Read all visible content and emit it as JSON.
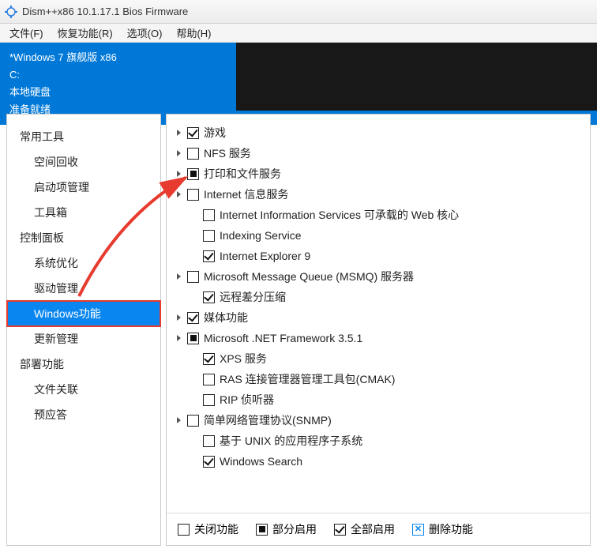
{
  "window": {
    "title": "Dism++x86 10.1.17.1 Bios Firmware"
  },
  "menu": {
    "file": "文件(F)",
    "recovery": "恢复功能(R)",
    "options": "选项(O)",
    "help": "帮助(H)"
  },
  "info": {
    "os": "*Windows 7 旗舰版 x86",
    "drive": "C:",
    "disk": "本地硬盘",
    "status": "准备就绪"
  },
  "sidebar": {
    "groups": [
      {
        "head": "常用工具",
        "items": [
          "空间回收",
          "启动项管理",
          "工具箱"
        ]
      },
      {
        "head": "控制面板",
        "items": [
          "系统优化",
          "驱动管理",
          "Windows功能",
          "更新管理"
        ]
      },
      {
        "head": "部署功能",
        "items": [
          "文件关联",
          "预应答"
        ]
      }
    ],
    "selected": "Windows功能"
  },
  "features": [
    {
      "expand": true,
      "check": "checked",
      "label": "游戏",
      "indent": 0
    },
    {
      "expand": true,
      "check": "none",
      "label": "NFS 服务",
      "indent": 0
    },
    {
      "expand": true,
      "check": "partial",
      "label": "打印和文件服务",
      "indent": 0
    },
    {
      "expand": true,
      "check": "none",
      "label": "Internet 信息服务",
      "indent": 0
    },
    {
      "expand": false,
      "check": "none",
      "label": "Internet Information Services 可承载的 Web 核心",
      "indent": 1
    },
    {
      "expand": false,
      "check": "none",
      "label": "Indexing Service",
      "indent": 1
    },
    {
      "expand": false,
      "check": "checked",
      "label": "Internet Explorer 9",
      "indent": 1
    },
    {
      "expand": true,
      "check": "none",
      "label": "Microsoft Message Queue (MSMQ) 服务器",
      "indent": 0
    },
    {
      "expand": false,
      "check": "checked",
      "label": "远程差分压缩",
      "indent": 1
    },
    {
      "expand": true,
      "check": "checked",
      "label": "媒体功能",
      "indent": 0
    },
    {
      "expand": true,
      "check": "partial",
      "label": "Microsoft .NET Framework 3.5.1",
      "indent": 0
    },
    {
      "expand": false,
      "check": "checked",
      "label": "XPS 服务",
      "indent": 1
    },
    {
      "expand": false,
      "check": "none",
      "label": "RAS 连接管理器管理工具包(CMAK)",
      "indent": 1
    },
    {
      "expand": false,
      "check": "none",
      "label": "RIP 侦听器",
      "indent": 1
    },
    {
      "expand": true,
      "check": "none",
      "label": "简单网络管理协议(SNMP)",
      "indent": 0
    },
    {
      "expand": false,
      "check": "none",
      "label": "基于 UNIX 的应用程序子系统",
      "indent": 1
    },
    {
      "expand": false,
      "check": "checked",
      "label": "Windows Search",
      "indent": 1
    }
  ],
  "legend": {
    "off": "关闭功能",
    "partial": "部分启用",
    "on": "全部启用",
    "remove": "删除功能"
  }
}
